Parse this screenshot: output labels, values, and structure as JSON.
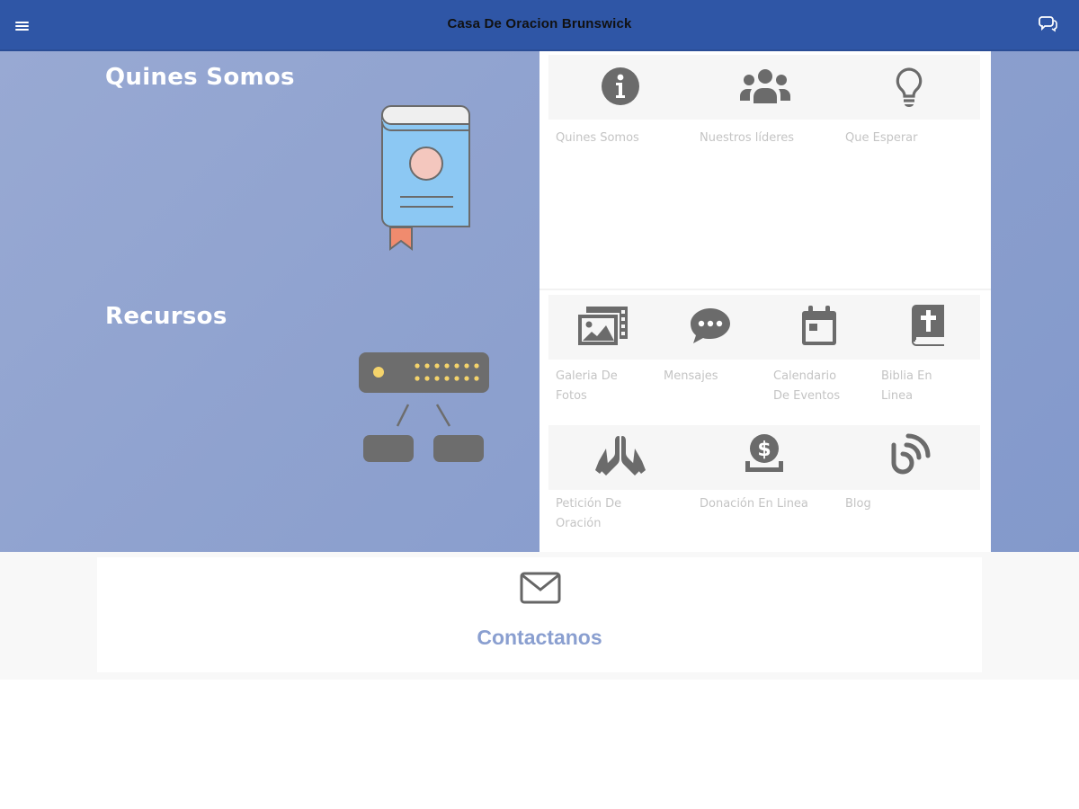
{
  "header": {
    "title": "Casa De Oracion Brunswick",
    "menu_icon": "hamburger-menu-icon",
    "chat_icon": "chat-bubbles-icon"
  },
  "sections": {
    "about": {
      "title": "Quines Somos",
      "illustration": "book-icon",
      "tiles": [
        {
          "label": "Quines Somos",
          "icon": "info-circle-icon"
        },
        {
          "label": "Nuestros líderes",
          "icon": "users-group-icon"
        },
        {
          "label": "Que Esperar",
          "icon": "lightbulb-icon"
        }
      ]
    },
    "resources": {
      "title": "Recursos",
      "illustration": "network-switch-icon",
      "tiles": [
        {
          "label_line1": "Galeria De",
          "label_line2": "Fotos",
          "icon": "photo-gallery-icon"
        },
        {
          "label_line1": "Mensajes",
          "label_line2": "",
          "icon": "speech-bubble-icon"
        },
        {
          "label_line1": "Calendario",
          "label_line2": "De Eventos",
          "icon": "calendar-icon"
        },
        {
          "label_line1": "Biblia En",
          "label_line2": "Linea",
          "icon": "bible-icon"
        },
        {
          "label_line1": "Petición De",
          "label_line2": "Oración",
          "icon": "praying-hands-icon"
        },
        {
          "label_line1": "Donación En Linea",
          "label_line2": "",
          "icon": "donation-icon"
        },
        {
          "label_line1": "Blog",
          "label_line2": "",
          "icon": "blog-rss-icon"
        }
      ]
    }
  },
  "contact": {
    "label": "Contactanos",
    "icon": "envelope-icon"
  },
  "colors": {
    "header_bg": "#2f56a6",
    "hero_bg": "#8fa2cf",
    "icon_gray": "#6b6b6b",
    "label_gray": "#c4c4c4",
    "contact_text": "#8a9fd0"
  }
}
